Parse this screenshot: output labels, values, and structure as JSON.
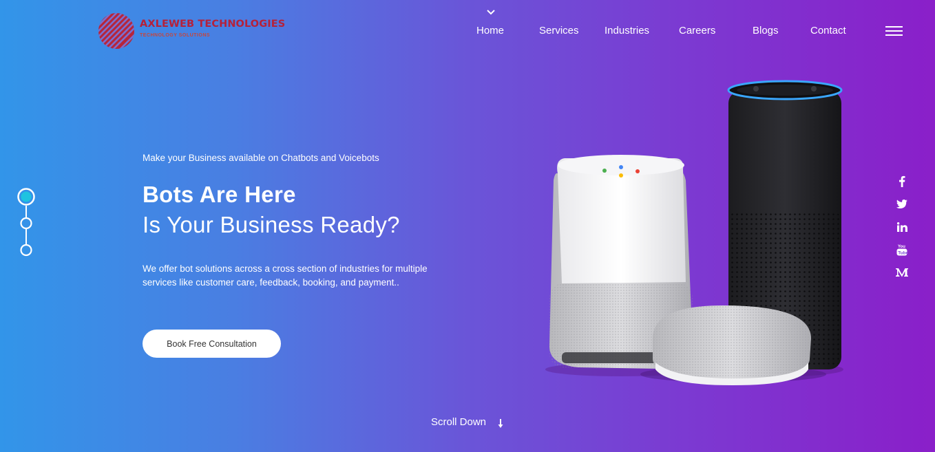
{
  "brand": {
    "name": "AXLEWEB TECHNOLOGIES",
    "tagline": "TECHNOLOGY SOLUTIONS",
    "color": "#b5213a"
  },
  "nav": {
    "items": [
      {
        "label": "Home"
      },
      {
        "label": "Services"
      },
      {
        "label": "Industries"
      },
      {
        "label": "Careers"
      },
      {
        "label": "Blogs"
      },
      {
        "label": "Contact"
      }
    ],
    "active_indicator_icon": "chevron-down-icon",
    "menu_icon": "hamburger-icon"
  },
  "hero": {
    "eyebrow": "Make your Business available on Chatbots and Voicebots",
    "title_line1": "Bots Are Here",
    "title_line2": "Is Your Business Ready?",
    "description": "We offer bot solutions across a cross section of industries for multiple services like customer care, feedback, booking, and payment..",
    "cta_label": "Book Free Consultation",
    "image_alt": "smart speakers"
  },
  "slider": {
    "slides": 3,
    "active_slide": 1,
    "active_color": "#1fc3e0"
  },
  "social": [
    {
      "name": "facebook-icon"
    },
    {
      "name": "twitter-icon"
    },
    {
      "name": "linkedin-icon"
    },
    {
      "name": "youtube-icon"
    },
    {
      "name": "medium-icon"
    }
  ],
  "scroll": {
    "label": "Scroll Down",
    "icon": "arrow-down-icon"
  },
  "colors": {
    "gradient_start": "#3295e9",
    "gradient_end": "#8a1fc9"
  }
}
